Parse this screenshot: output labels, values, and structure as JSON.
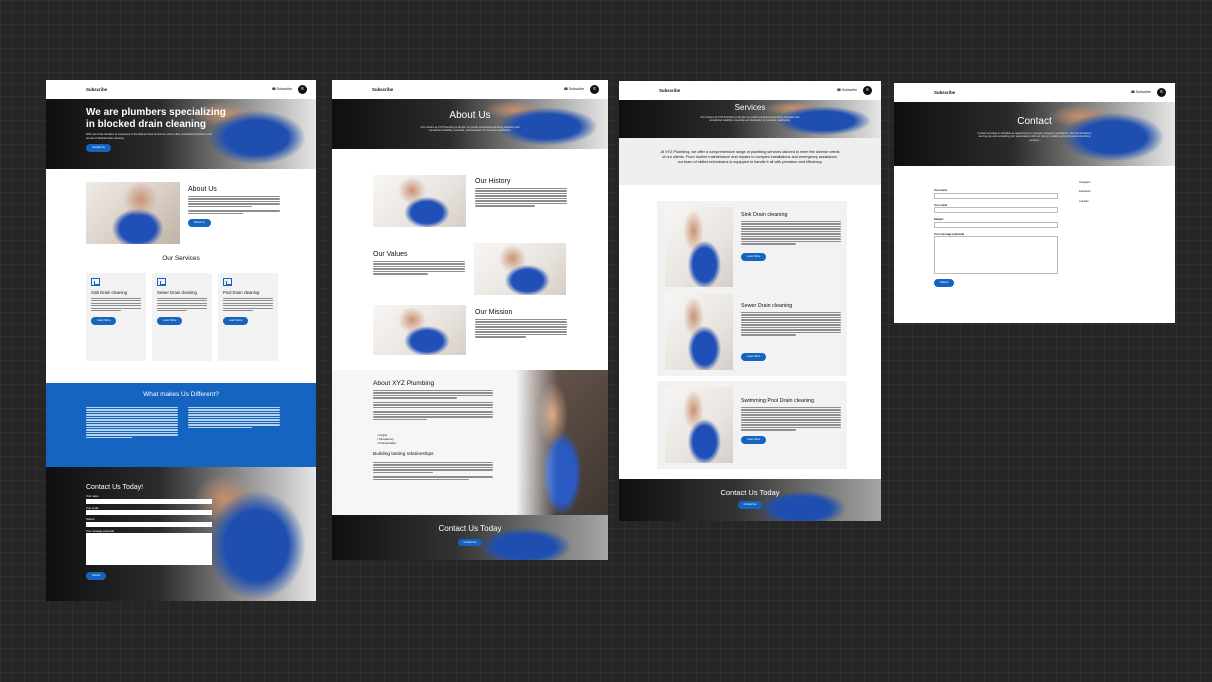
{
  "nav": {
    "brand": "Subscribe",
    "link": "☎ Subscribe",
    "menu_icon": "≡"
  },
  "home": {
    "hero_title": "We are plumbers specializing in blocked drain cleaning",
    "hero_text": "With over three decades of experience in the field we have honed our craft to offer unmatched precision in the service of blocked drain cleaning.",
    "hero_button": "Contact Us",
    "about_title": "About Us",
    "about_button": "About Us",
    "services_title": "Our Services",
    "services": [
      {
        "title": "Sink Drain cleaning",
        "button": "Learn More"
      },
      {
        "title": "Sewer Drain cleaning",
        "button": "Learn More"
      },
      {
        "title": "Pool Drain cleaning",
        "button": "Learn More"
      }
    ],
    "why_title": "What makes Us Different?",
    "contact_title": "Contact Us Today!",
    "form": {
      "name": "Your name",
      "email": "Your email",
      "subject": "Subject",
      "message": "Your message (optional)",
      "submit": "Submit"
    }
  },
  "about": {
    "hero_title": "About Us",
    "hero_text": "Our mission at XYZ Plumbing is simple: to provide exceptional plumbing solutions with unmatched reliability, expertise, and dedication to customer satisfaction.",
    "history_title": "Our History",
    "values_title": "Our Values",
    "mission_title": "Our Mission",
    "xyz_title": "About XYZ Plumbing",
    "bullets": [
      "Integrity",
      "Transparency",
      "Professionalism"
    ],
    "building_title": "Building lasting relationships",
    "cta_title": "Contact Us Today",
    "cta_button": "Contact Us"
  },
  "services": {
    "hero_title": "Services",
    "hero_text": "Our mission at XYZ Plumbing is simple: to provide exceptional plumbing solutions with unmatched reliability, expertise and dedication to customer satisfaction.",
    "intro": "At XYZ Plumbing, we offer a comprehensive range of plumbing services tailored to meet the diverse needs of our clients. From routine maintenance and repairs to complex installations and emergency assistance, our team of skilled technicians is equipped to handle it all with precision and efficiency.",
    "items": [
      {
        "title": "Sink Drain cleaning",
        "button": "Learn More"
      },
      {
        "title": "Sewer Drain cleaning",
        "button": "Learn More"
      },
      {
        "title": "Swimming Pool Drain cleaning",
        "button": "Learn More"
      }
    ],
    "cta_title": "Contact Us Today",
    "cta_button": "Contact Us"
  },
  "contact": {
    "hero_title": "Contact",
    "hero_text": "Contact us today to schedule an appointment or request emergency assistance. We look forward to serving you and exceeding your expectations with our prompt, reliable, and professional plumbing services.",
    "form": {
      "name": "Your name",
      "email": "Your email",
      "subject": "Subject",
      "message": "Your message (optional)",
      "submit": "Submit"
    },
    "side_links": [
      "Instagram",
      "Facebook",
      "Linkedin"
    ]
  },
  "colors": {
    "accent": "#1565c0",
    "page_bg": "#262626"
  }
}
